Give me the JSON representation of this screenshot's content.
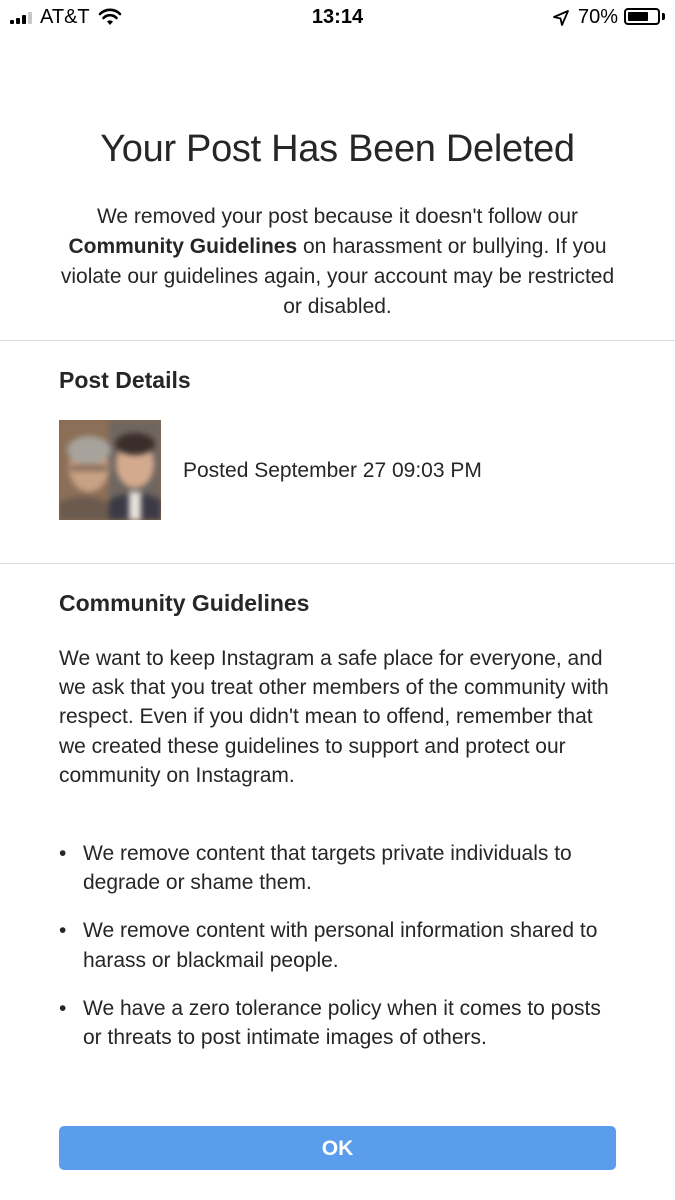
{
  "status_bar": {
    "carrier": "AT&T",
    "time": "13:14",
    "battery_percent_label": "70%",
    "battery_level": 0.7,
    "signal_bars_filled": 3,
    "signal_bars_total": 4,
    "icons": [
      "signal-icon",
      "wifi-icon",
      "location-arrow-icon",
      "battery-icon"
    ]
  },
  "dialog": {
    "title": "Your Post Has Been Deleted",
    "intro_before": "We removed your post because it doesn't follow our ",
    "intro_bold": "Community Guidelines",
    "intro_after": " on harassment or bullying. If you violate our guidelines again, your account may be restricted or disabled."
  },
  "post_details": {
    "heading": "Post Details",
    "posted_text": "Posted September 27 09:03 PM"
  },
  "guidelines": {
    "heading": "Community Guidelines",
    "body": "We want to keep Instagram a safe place for everyone, and we ask that you treat other members of the community with respect. Even if you didn't mean to offend, remember that we created these guidelines to support and protect our community on Instagram.",
    "bullets": [
      "We remove content that targets private individuals to degrade or shame them.",
      "We remove content with personal information shared to harass or blackmail people.",
      "We have a zero tolerance policy when it comes to posts or threats to post intimate images of others."
    ]
  },
  "actions": {
    "ok_label": "OK"
  },
  "colors": {
    "button": "#5b9ded",
    "text": "#262626",
    "divider": "#dbdbdb"
  }
}
